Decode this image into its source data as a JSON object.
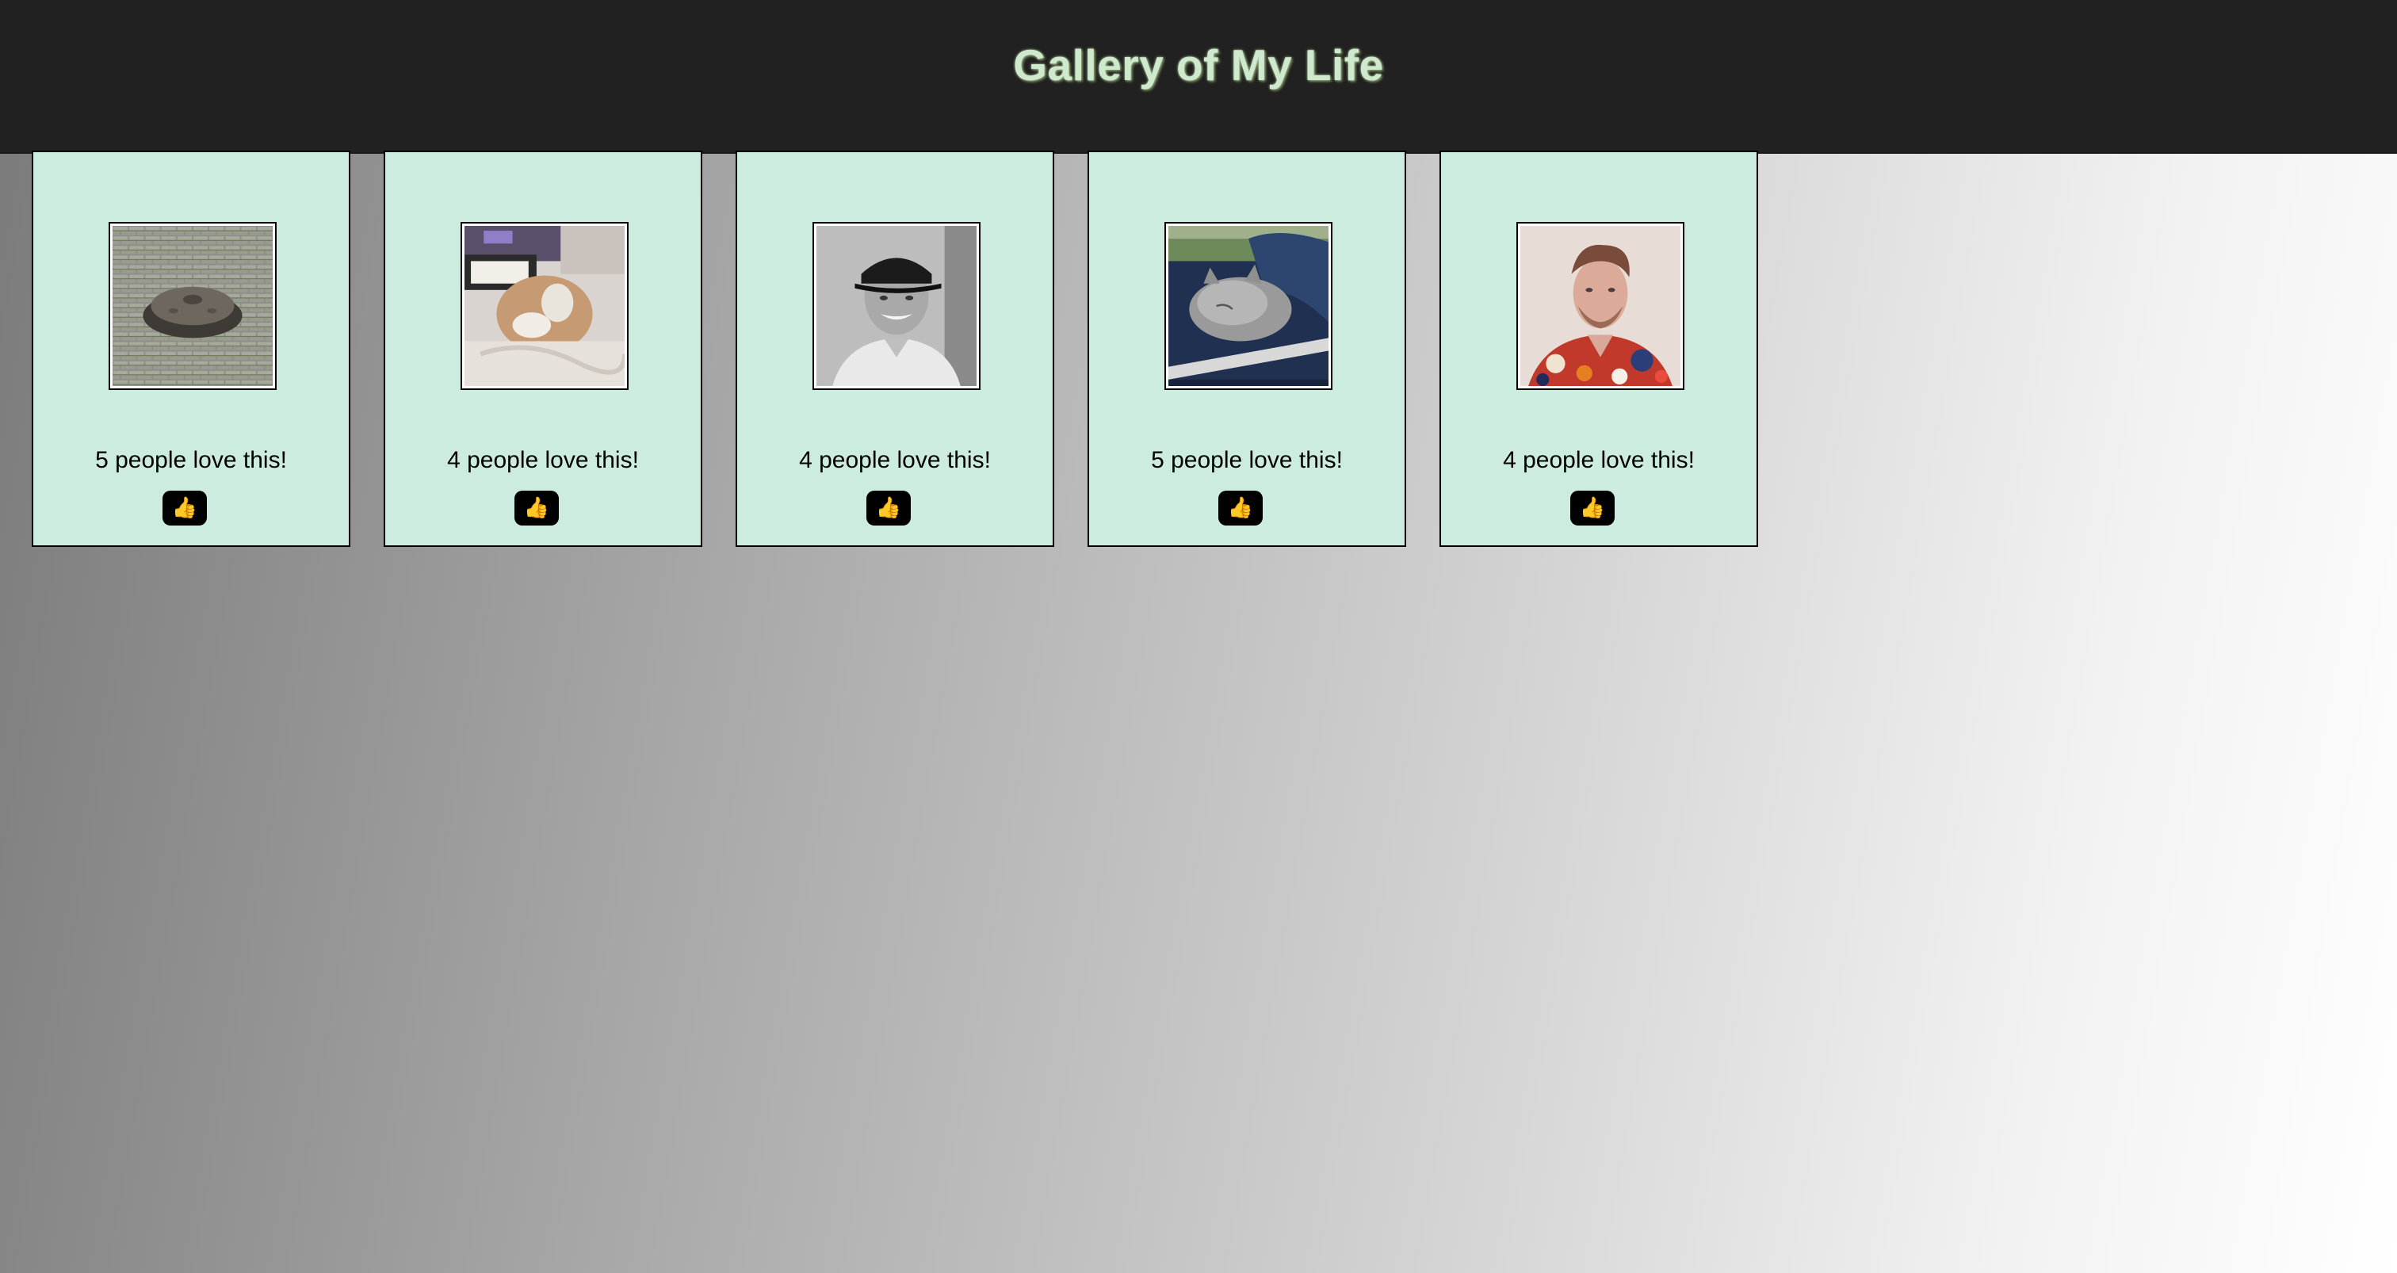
{
  "header": {
    "title": "Gallery of My Life"
  },
  "cards": [
    {
      "image_subject": "handpan drum on brick pavement",
      "love_text": "5 people love this!",
      "like_icon": "👍"
    },
    {
      "image_subject": "cat lying on bed",
      "love_text": "4 people love this!",
      "like_icon": "👍"
    },
    {
      "image_subject": "smiling man in cap, black and white",
      "love_text": "4 people love this!",
      "like_icon": "👍"
    },
    {
      "image_subject": "grey tabby kitten",
      "love_text": "5 people love this!",
      "like_icon": "👍"
    },
    {
      "image_subject": "man in floral shirt",
      "love_text": "4 people love this!",
      "like_icon": "👍"
    }
  ],
  "colors": {
    "header_bg": "#212121",
    "title_color": "#cfe9cf",
    "card_bg": "#cdece0",
    "button_bg": "#000000"
  }
}
